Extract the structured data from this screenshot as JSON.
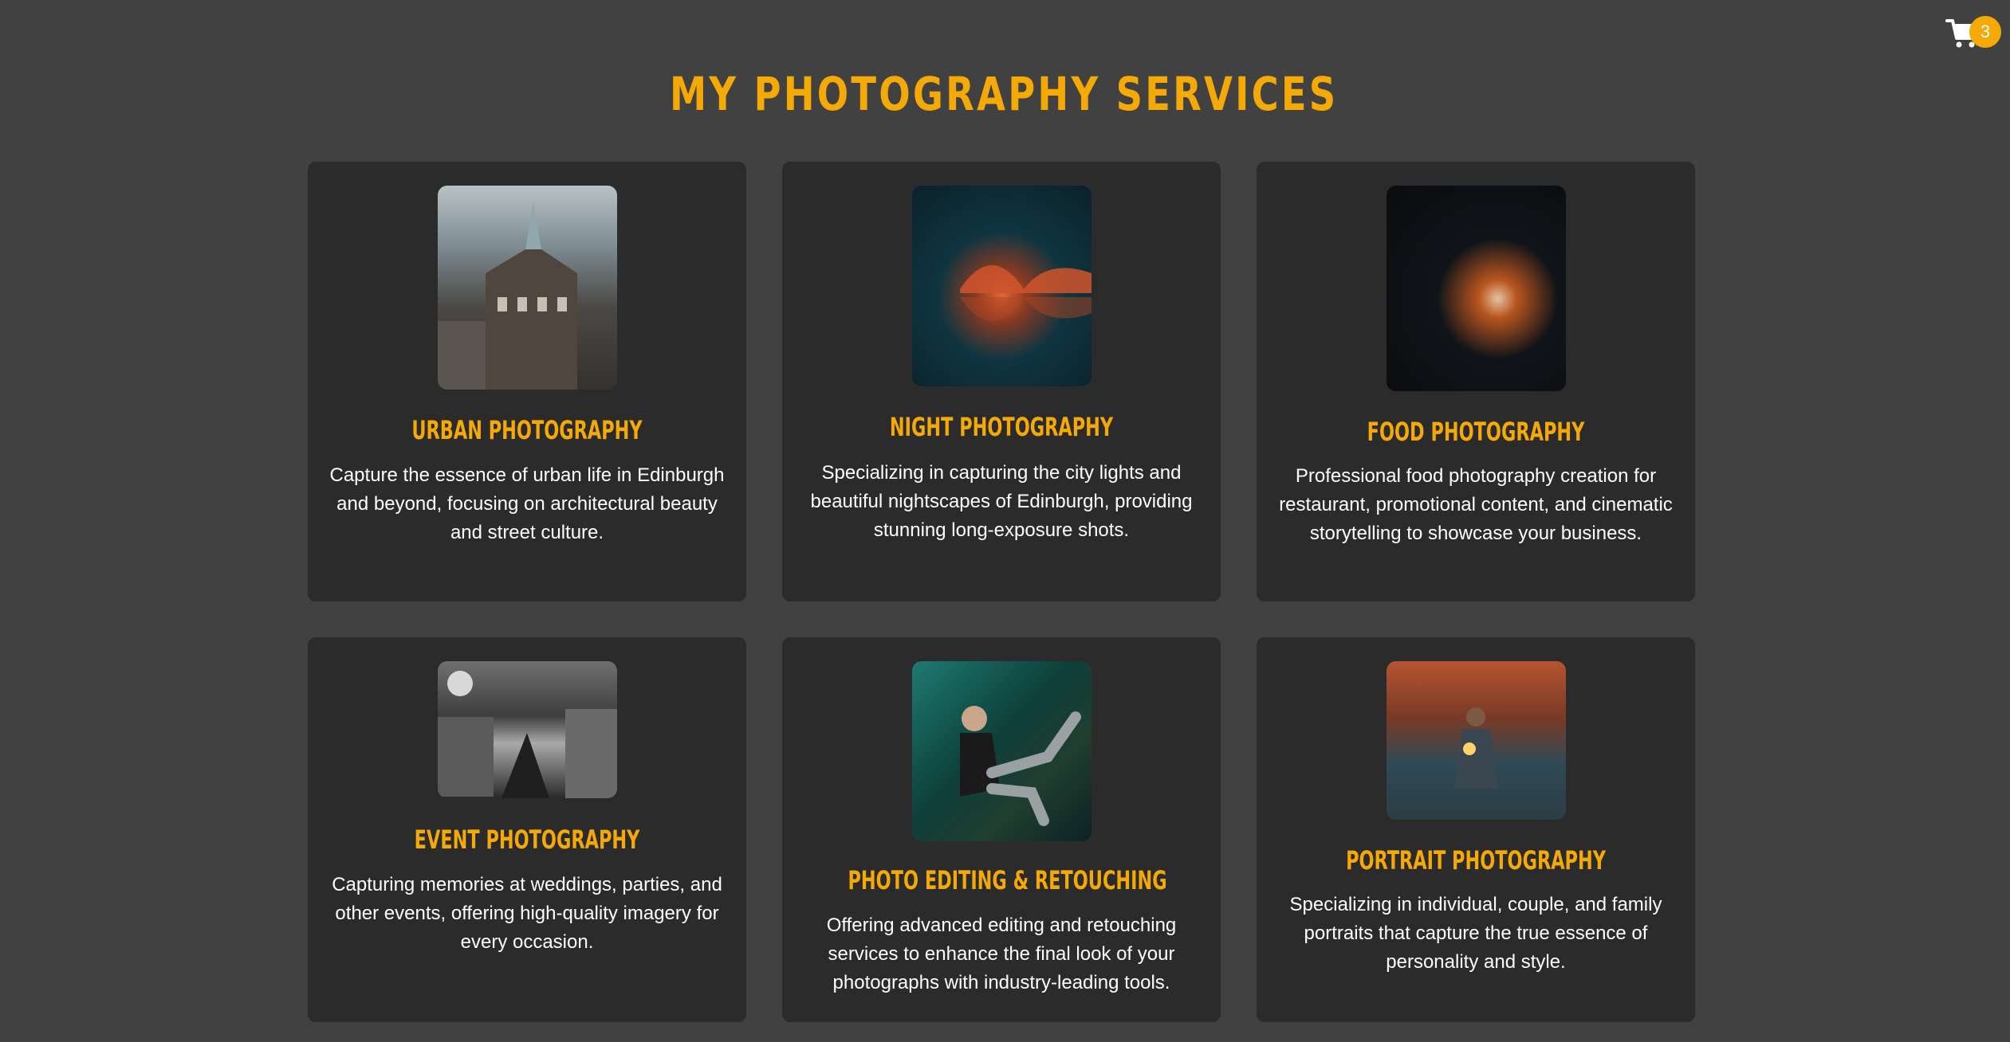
{
  "header": {
    "title": "MY PHOTOGRAPHY SERVICES",
    "cart_count": "3",
    "cart_icon": "shopping-cart-icon"
  },
  "colors": {
    "background": "#424142",
    "card": "#2c2b2c",
    "accent": "#f5a905",
    "text": "#ffffff"
  },
  "services": [
    {
      "title": "URBAN PHOTOGRAPHY",
      "description": "Capture the essence of urban life in Edinburgh and beyond, focusing on architectural beauty and street culture.",
      "image": "edinburgh-building-photo"
    },
    {
      "title": "NIGHT PHOTOGRAPHY",
      "description": "Specializing in capturing the city lights and beautiful nightscapes of Edinburgh, providing stunning long-exposure shots.",
      "image": "illuminated-bridge-night-photo"
    },
    {
      "title": "FOOD PHOTOGRAPHY",
      "description": "Professional food photography creation for restaurant, promotional content, and cinematic storytelling to showcase your business.",
      "image": "sushi-roll-photo"
    },
    {
      "title": "EVENT PHOTOGRAPHY",
      "description": "Capturing memories at weddings, parties, and other events, offering high-quality imagery for every occasion.",
      "image": "canal-street-night-photo"
    },
    {
      "title": "PHOTO EDITING & RETOUCHING",
      "description": "Offering advanced editing and retouching services to enhance the final look of your photographs with industry-leading tools.",
      "image": "woman-sitting-photo"
    },
    {
      "title": "PORTRAIT PHOTOGRAPHY",
      "description": "Specializing in individual, couple, and family portraits that capture the true essence of personality and style.",
      "image": "portrait-with-light-photo"
    }
  ]
}
